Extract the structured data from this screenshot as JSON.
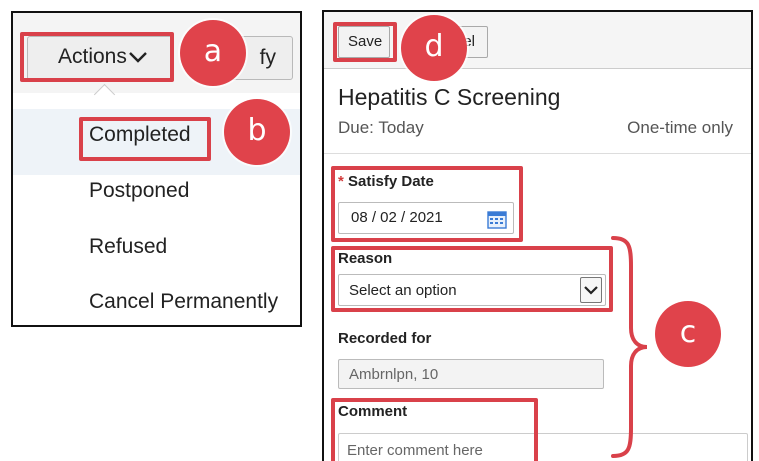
{
  "left": {
    "actions_label": "Actions",
    "satisfy_label": "fy",
    "menu": [
      {
        "label": "Completed"
      },
      {
        "label": "Postponed"
      },
      {
        "label": "Refused"
      },
      {
        "label": "Cancel Permanently"
      }
    ]
  },
  "badges": {
    "a": "a",
    "b": "b",
    "c": "c",
    "d": "d"
  },
  "right": {
    "save_label": "Save",
    "cancel_label": "el",
    "title": "Hepatitis C Screening",
    "due": "Due: Today",
    "frequency": "One-time only",
    "satisfy_date": {
      "required_mark": "*",
      "label": "Satisfy Date",
      "value": "08 / 02 / 2021"
    },
    "reason": {
      "label": "Reason",
      "value": "Select an option"
    },
    "recorded_for": {
      "label": "Recorded for",
      "value": "Ambrnlpn, 10"
    },
    "comment": {
      "label": "Comment",
      "placeholder": "Enter comment here"
    }
  },
  "colors": {
    "highlight": "#d9414a",
    "badge": "#e0434b",
    "calendar": "#3a7bd5"
  },
  "icons": [
    "chevron-down-icon",
    "calendar-icon",
    "dropdown-arrow-icon",
    "curly-brace"
  ]
}
